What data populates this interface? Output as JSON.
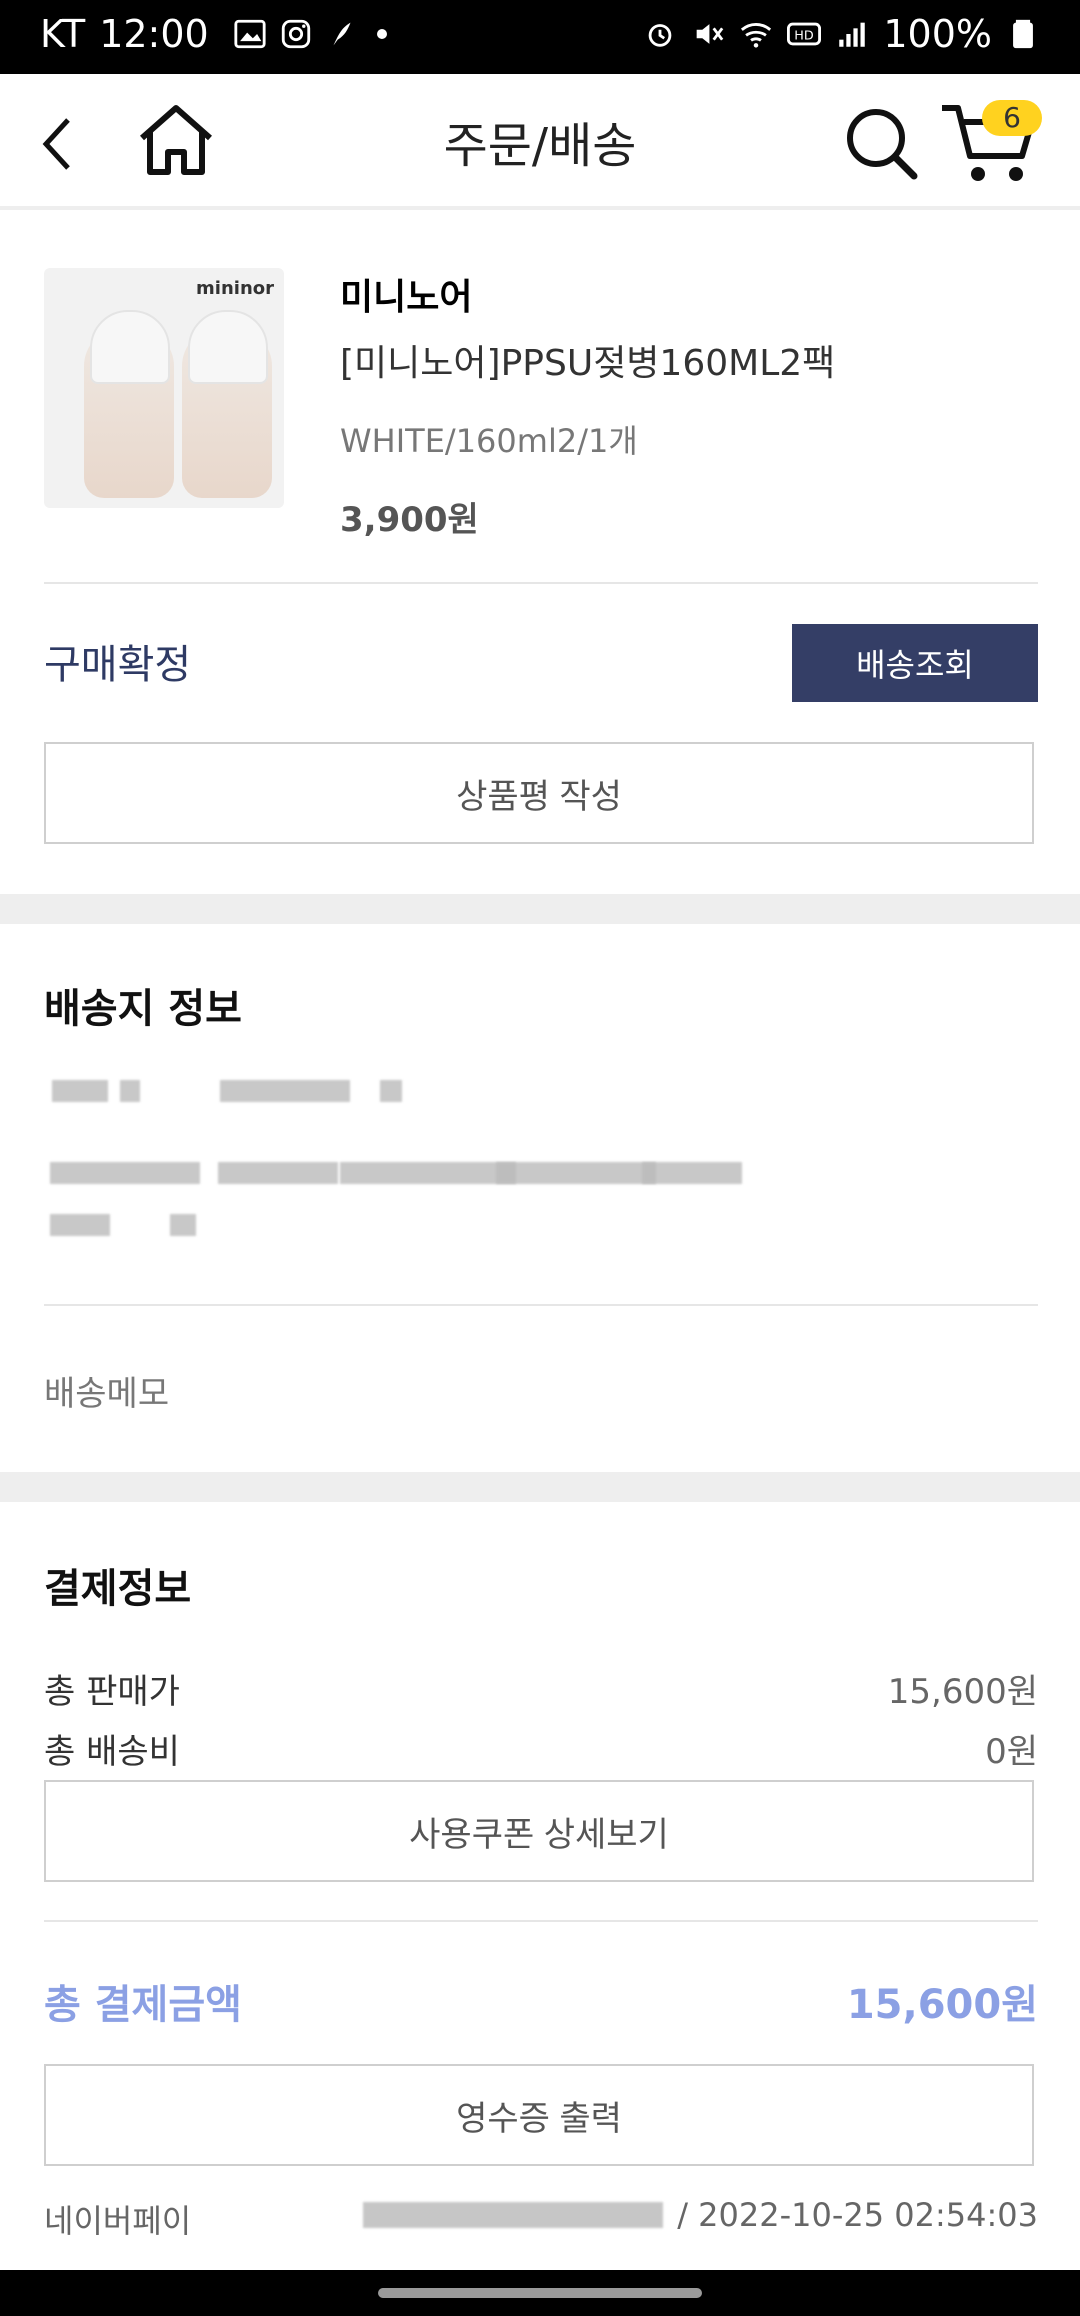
{
  "status_bar": {
    "carrier": "KT",
    "time": "12:00",
    "battery": "100%"
  },
  "header": {
    "title": "주문/배송",
    "cart_count": "6"
  },
  "product": {
    "image_brand_text": "mininor",
    "brand": "미니노어",
    "name": "[미니노어]PPSU젖병160ML2팩",
    "option": "WHITE/160ml2/1개",
    "price": "3,900원"
  },
  "order_actions": {
    "status": "구매확정",
    "track_label": "배송조회",
    "review_label": "상품평 작성"
  },
  "shipping": {
    "title": "배송지 정보",
    "memo_label": "배송메모"
  },
  "payment": {
    "title": "결제정보",
    "rows": [
      {
        "label": "총 판매가",
        "value": "15,600원"
      },
      {
        "label": "총 배송비",
        "value": "0원"
      }
    ],
    "coupon_label": "사용쿠폰 상세보기",
    "total_label": "총 결제금액",
    "total_value": "15,600원",
    "receipt_label": "영수증 출력",
    "method": "네이버페이",
    "datetime": "/ 2022-10-25 02:54:03"
  },
  "colors": {
    "accent_navy": "#343e66",
    "total_blue": "#8ba0e4",
    "badge_yellow": "#ffd21f"
  }
}
